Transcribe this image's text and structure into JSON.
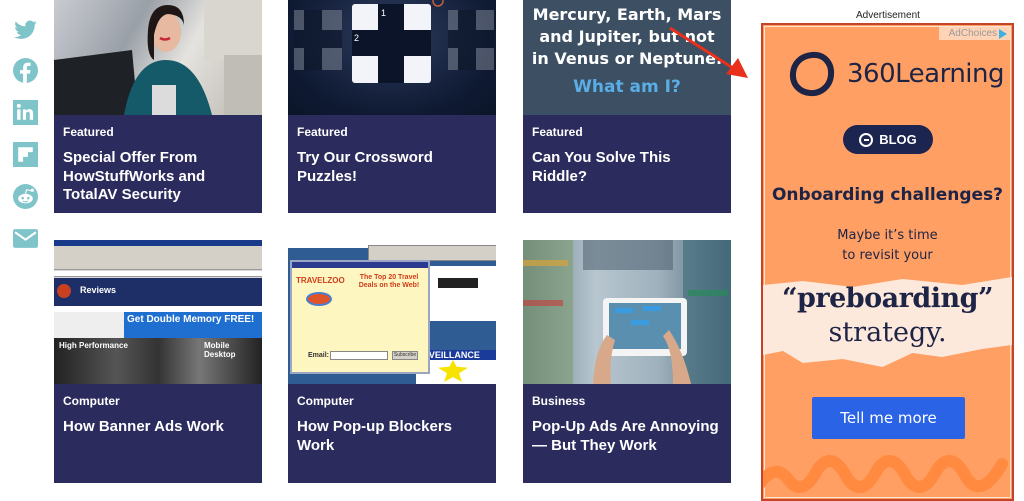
{
  "share": {
    "items": [
      {
        "name": "twitter",
        "icon": "twitter-icon"
      },
      {
        "name": "facebook",
        "icon": "facebook-icon"
      },
      {
        "name": "linkedin",
        "icon": "linkedin-icon"
      },
      {
        "name": "flipboard",
        "icon": "flipboard-icon"
      },
      {
        "name": "reddit",
        "icon": "reddit-icon"
      },
      {
        "name": "email",
        "icon": "email-icon"
      }
    ],
    "color": "#7fc4c9"
  },
  "cards": [
    {
      "category": "Featured",
      "title": "Special Offer From HowStuffWorks and TotalAV Security",
      "image": "woman-with-laptop"
    },
    {
      "category": "Featured",
      "title": "Try Our Crossword Puzzles!",
      "image": "crossword-grid",
      "grid_numbers": [
        "1",
        "2"
      ]
    },
    {
      "category": "Featured",
      "title": "Can You Solve This Riddle?",
      "image": "riddle",
      "riddle_text": "Mercury, Earth, Mars and Jupiter, but not in Venus or Neptune.",
      "riddle_question": "What am I?"
    },
    {
      "category": "Computer",
      "title": "How Banner Ads Work",
      "image": "banner-ad-screenshot",
      "image_text": {
        "site": "Reviews",
        "banner": "Get Double Memory FREE!",
        "left": "High Performance",
        "right": "Mobile Desktop"
      }
    },
    {
      "category": "Computer",
      "title": "How Pop-up Blockers Work",
      "image": "popup-screenshot",
      "image_text": {
        "brand": "TRAVELZOO",
        "headline": "The Top 20 Travel Deals on the Web!",
        "email_label": "Email:",
        "button": "Subscribe",
        "banner": "URVEILLANCE"
      }
    },
    {
      "category": "Business",
      "title": "Pop-Up Ads Are Annoying — But They Work",
      "image": "tablet-in-store"
    }
  ],
  "ad": {
    "label": "Advertisement",
    "adchoices": "AdChoices",
    "brand": "360Learning",
    "blog_label": "BLOG",
    "headline": "Onboarding challenges?",
    "sub_line1": "Maybe it’s time",
    "sub_line2": "to revisit your",
    "highlight": "“preboarding”",
    "highlight2": "strategy.",
    "cta": "Tell me more",
    "colors": {
      "bg": "#ff9f63",
      "navy": "#1d2445",
      "cta": "#2b63e6",
      "border": "#c4442a"
    }
  },
  "annotation": {
    "type": "red-arrow",
    "color": "#e8301c",
    "points_to": "advertisement"
  }
}
